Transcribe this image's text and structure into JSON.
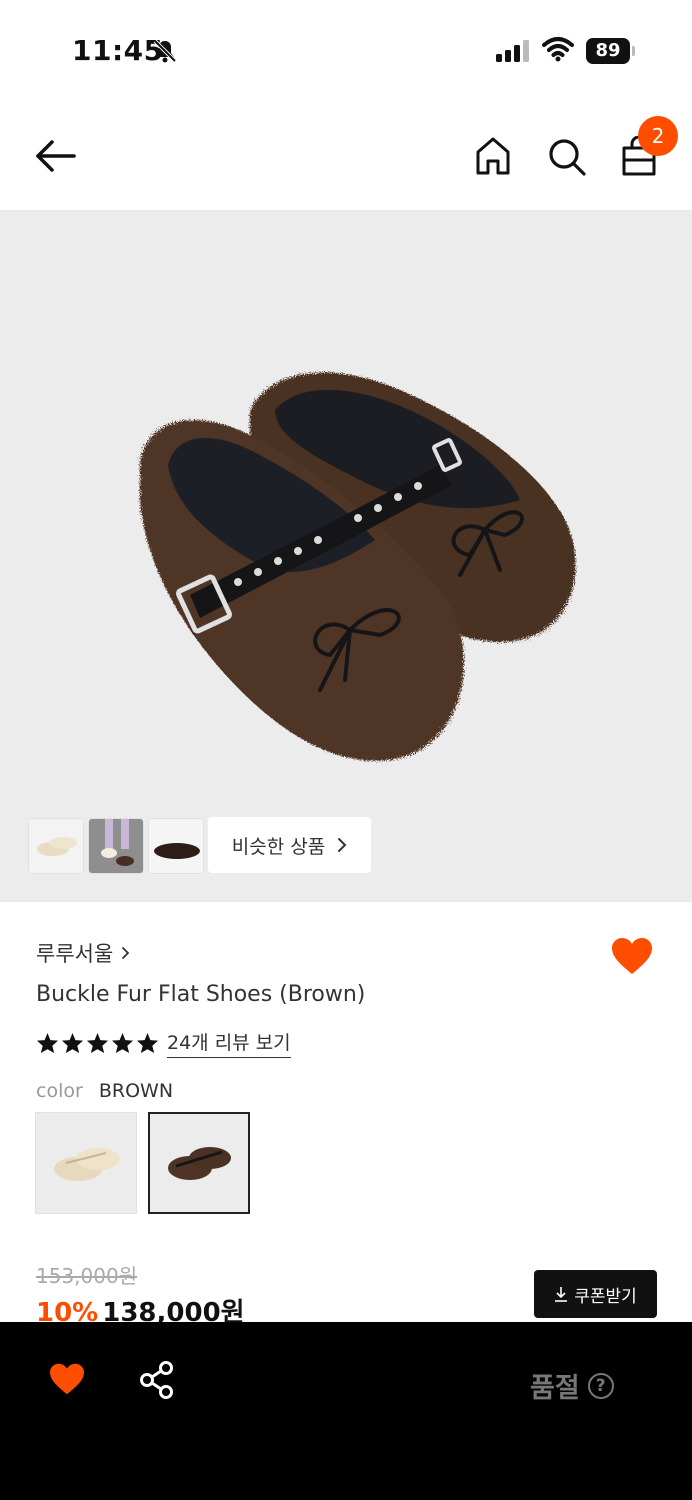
{
  "status_bar": {
    "time": "11:45",
    "battery": "89"
  },
  "header": {
    "cart_count": "2"
  },
  "gallery": {
    "thumbnails": [
      "beige-shoes-thumb",
      "model-shoes-thumb",
      "brown-shoe-thumb"
    ],
    "similar_label": "비슷한 상품"
  },
  "product": {
    "brand": "루루서울",
    "title": "Buckle Fur Flat Shoes (Brown)",
    "rating": 5,
    "review_link": "24개 리뷰 보기",
    "color_label": "color",
    "color_value": "BROWN",
    "swatches": [
      "beige",
      "brown"
    ],
    "original_price": "153,000원",
    "discount": "10%",
    "price": "138,000원",
    "coupon_label": "쿠폰받기"
  },
  "bottom_bar": {
    "soldout_label": "품절",
    "help_icon": "?"
  },
  "colors": {
    "accent": "#ff4d00",
    "dark": "#111111"
  }
}
